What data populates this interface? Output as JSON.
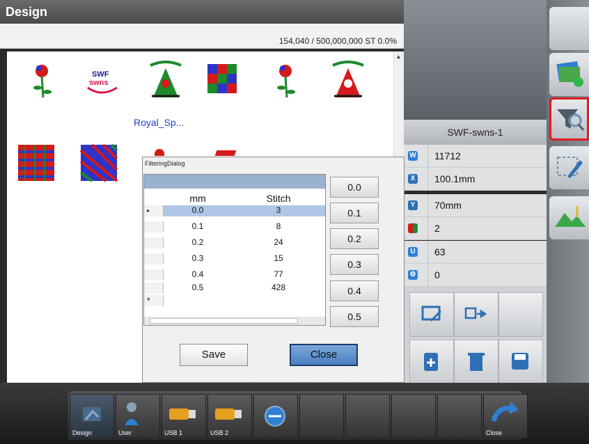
{
  "header": {
    "title": "Design"
  },
  "stats": {
    "text": "154,040 / 500,000,000 ST  0.0%"
  },
  "design_list": {
    "selected_name": "Royal_Sp...",
    "thumbnails": [
      "rose",
      "swf-logo",
      "royal-spring",
      "pattern-multicolor",
      "rose",
      "royal-spring-red",
      "tile-pattern",
      "checker-pattern",
      "rose-partial",
      "red-partial"
    ]
  },
  "info_panel": {
    "title": "SWF-swns-1",
    "rows": [
      {
        "icon": "stitch-count-icon",
        "value": "11712"
      },
      {
        "icon": "width-x-icon",
        "value": "100.1mm"
      },
      {
        "icon": "height-y-icon",
        "value": "70mm"
      },
      {
        "icon": "color-icon",
        "value": "2"
      },
      {
        "icon": "needle-change-icon",
        "value": "63"
      },
      {
        "icon": "gear-settings-icon",
        "value": "0"
      }
    ]
  },
  "dialog": {
    "title": "FilteringDialog",
    "columns": [
      "mm",
      "Stitch"
    ],
    "rows": [
      {
        "mm": "0.0",
        "stitch": "3",
        "selected": true
      },
      {
        "mm": "0.1",
        "stitch": "8"
      },
      {
        "mm": "0.2",
        "stitch": "24"
      },
      {
        "mm": "0.3",
        "stitch": "15"
      },
      {
        "mm": "0.4",
        "stitch": "77"
      },
      {
        "mm": "0.5",
        "stitch": "428"
      }
    ],
    "new_row_marker": "*",
    "mm_buttons": [
      "0.0",
      "0.1",
      "0.2",
      "0.3",
      "0.4",
      "0.5"
    ],
    "save_label": "Save",
    "close_label": "Close"
  },
  "bottom_nav": {
    "items": [
      {
        "label": "Design",
        "icon": "design-icon"
      },
      {
        "label": "User",
        "icon": "user-icon"
      },
      {
        "label": "USB 1",
        "icon": "usb-icon"
      },
      {
        "label": "USB 2",
        "icon": "usb-icon"
      },
      {
        "label": "",
        "icon": "ses-icon"
      },
      {
        "label": "",
        "icon": ""
      },
      {
        "label": "",
        "icon": ""
      },
      {
        "label": "",
        "icon": ""
      },
      {
        "label": "",
        "icon": ""
      },
      {
        "label": "Close",
        "icon": "undo-close-icon"
      }
    ]
  },
  "colors": {
    "accent": "#e01c1c",
    "selection": "#b0c6e6",
    "close_button": "#4a7fbe"
  }
}
